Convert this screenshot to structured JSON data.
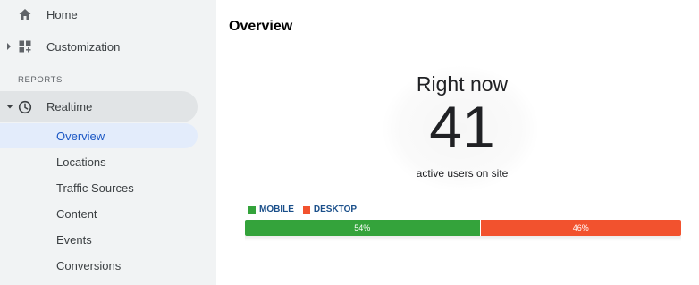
{
  "sidebar": {
    "home_label": "Home",
    "customization_label": "Customization",
    "section_header": "REPORTS",
    "realtime_label": "Realtime",
    "sub_items": [
      {
        "label": "Overview",
        "active": true
      },
      {
        "label": "Locations",
        "active": false
      },
      {
        "label": "Traffic Sources",
        "active": false
      },
      {
        "label": "Content",
        "active": false
      },
      {
        "label": "Events",
        "active": false
      },
      {
        "label": "Conversions",
        "active": false
      }
    ]
  },
  "main": {
    "title": "Overview",
    "right_now_label": "Right now",
    "active_users": "41",
    "active_users_caption": "active users on site",
    "legend": [
      {
        "label": "MOBILE",
        "color": "#34a33b"
      },
      {
        "label": "DESKTOP",
        "color": "#f2522e"
      }
    ],
    "device_split": [
      {
        "name": "MOBILE",
        "percent": 54,
        "label": "54%",
        "color": "#34a33b"
      },
      {
        "name": "DESKTOP",
        "percent": 46,
        "label": "46%",
        "color": "#f2522e"
      }
    ]
  },
  "colors": {
    "sidebar_bg": "#f1f3f4",
    "active_item_bg": "#e3ecfb",
    "active_item_text": "#1a56c4"
  },
  "icons": {
    "home": "home-icon",
    "customization": "dashboard-plus-icon",
    "realtime": "clock-icon"
  }
}
